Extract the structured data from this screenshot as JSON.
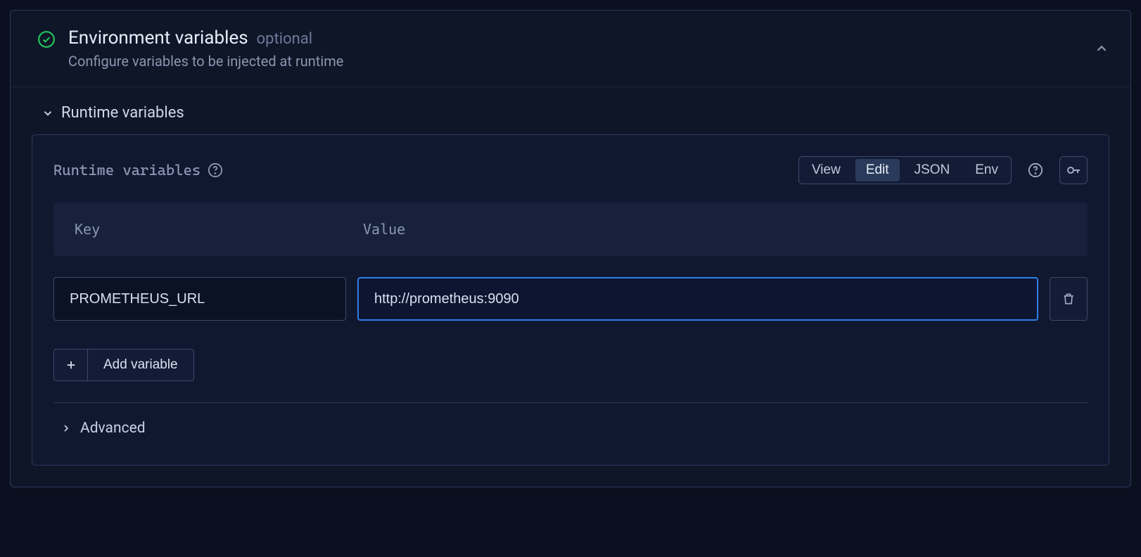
{
  "header": {
    "title": "Environment variables",
    "optional_label": "optional",
    "subtitle": "Configure variables to be injected at runtime"
  },
  "section": {
    "title": "Runtime variables"
  },
  "inner": {
    "title": "Runtime variables",
    "tabs": {
      "view": "View",
      "edit": "Edit",
      "json": "JSON",
      "env": "Env"
    }
  },
  "table": {
    "col_key": "Key",
    "col_value": "Value"
  },
  "variables": [
    {
      "key": "PROMETHEUS_URL",
      "value": "http://prometheus:9090"
    }
  ],
  "add_button": "Add variable",
  "advanced_label": "Advanced"
}
